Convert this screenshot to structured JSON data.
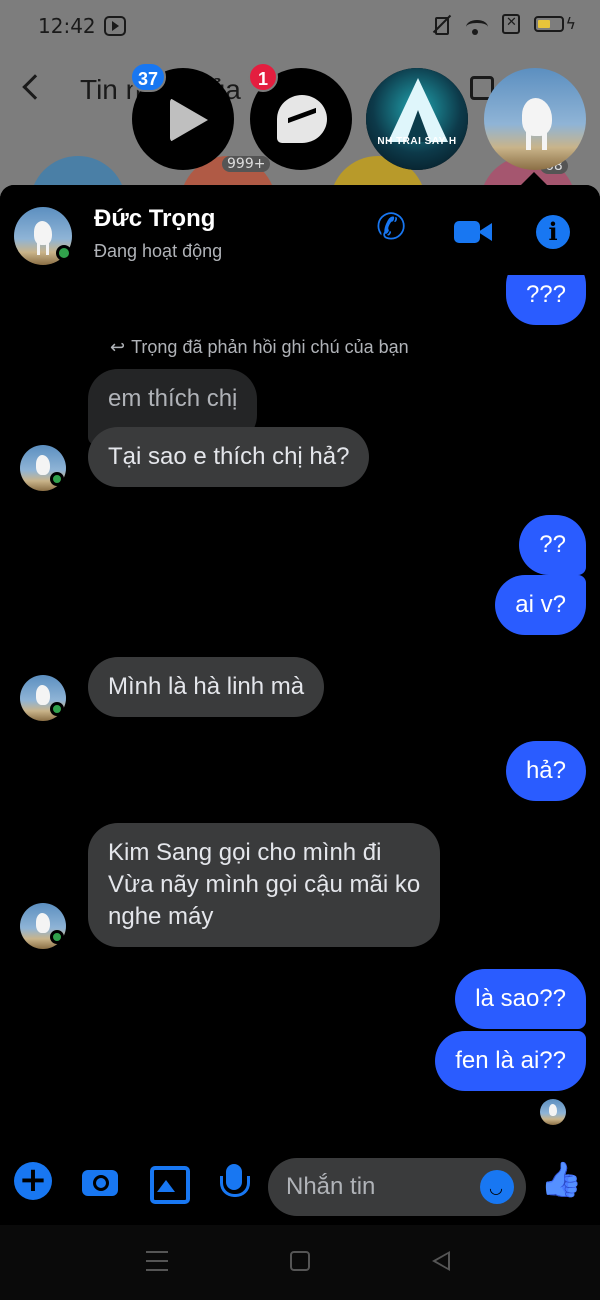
{
  "status_bar": {
    "time": "12:42"
  },
  "background_screen": {
    "title": "Tin nhắn của",
    "badge": "999+",
    "badge2": "68"
  },
  "chat_heads": [
    {
      "name": "play-chathead",
      "badge": "37",
      "badge_color": "#1877f2"
    },
    {
      "name": "messenger-chathead",
      "badge": "1",
      "badge_color": "#e41e3f"
    },
    {
      "name": "camp-chathead",
      "label": "NH TRAI SAY H"
    },
    {
      "name": "contact-chathead"
    }
  ],
  "chat": {
    "contact_name": "Đức Trọng",
    "contact_status": "Đang hoạt động",
    "reply_note": "Trọng đã phản hồi ghi chú của bạn",
    "messages": [
      {
        "side": "out",
        "text": "???"
      },
      {
        "side": "in-muted",
        "text": "em thích chị"
      },
      {
        "side": "in",
        "text": "Tại sao e thích chị hả?"
      },
      {
        "side": "out",
        "text": "??"
      },
      {
        "side": "out",
        "text": "ai v?"
      },
      {
        "side": "in",
        "text": "Mình là hà linh mà"
      },
      {
        "side": "out",
        "text": "hả?"
      },
      {
        "side": "in",
        "lines": [
          "Kim Sang gọi cho mình đi",
          "Vừa nãy mình gọi cậu mãi ko",
          "nghe máy"
        ]
      },
      {
        "side": "out",
        "text": "là sao??"
      },
      {
        "side": "out",
        "text": "fen là ai??"
      }
    ]
  },
  "composer": {
    "placeholder": "Nhắn tin"
  },
  "colors": {
    "accent": "#1877f2",
    "outgoing_bubble": "#2a5cff",
    "incoming_bubble": "#3a3b3c",
    "online": "#31a24c"
  },
  "icons": [
    "back-icon",
    "call-icon",
    "video-call-icon",
    "info-icon",
    "plus-icon",
    "camera-icon",
    "gallery-icon",
    "mic-icon",
    "emoji-icon",
    "like-icon"
  ]
}
